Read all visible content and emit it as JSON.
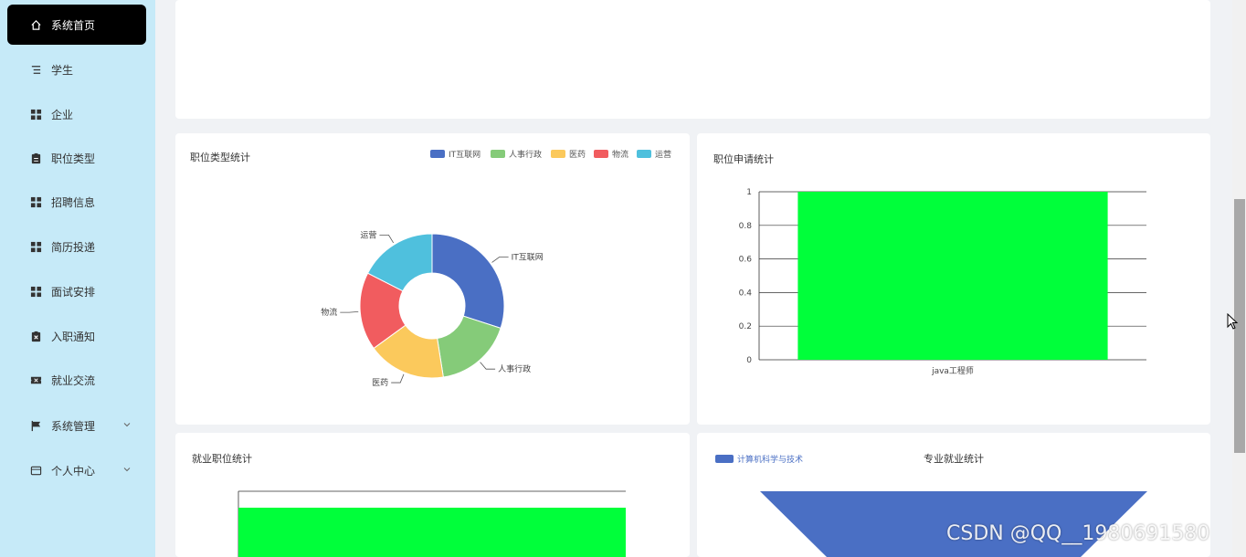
{
  "sidebar": {
    "items": [
      {
        "label": "系统首页",
        "icon": "home-icon"
      },
      {
        "label": "学生",
        "icon": "list-icon"
      },
      {
        "label": "企业",
        "icon": "grid-icon"
      },
      {
        "label": "职位类型",
        "icon": "clipboard-icon"
      },
      {
        "label": "招聘信息",
        "icon": "grid-icon"
      },
      {
        "label": "简历投递",
        "icon": "grid-icon"
      },
      {
        "label": "面试安排",
        "icon": "grid-icon"
      },
      {
        "label": "入职通知",
        "icon": "clipboard-x-icon"
      },
      {
        "label": "就业交流",
        "icon": "ticket-icon"
      },
      {
        "label": "系统管理",
        "icon": "flag-icon"
      },
      {
        "label": "个人中心",
        "icon": "card-icon"
      }
    ]
  },
  "colors": {
    "sidebar_bg": "#c6eaf8",
    "active_bg": "#000000",
    "bar_green": "#00ff3a",
    "funnel_blue": "#4a6fc4"
  },
  "charts": {
    "job_type": {
      "title": "职位类型统计"
    },
    "job_apply": {
      "title": "职位申请统计"
    },
    "employment_position": {
      "title": "就业职位统计"
    },
    "major_employment": {
      "title": "专业就业统计"
    }
  },
  "watermark": "CSDN @QQ__1980691580",
  "chart_data": [
    {
      "type": "pie",
      "title": "职位类型统计",
      "legend_position": "top-right",
      "categories": [
        "IT互联网",
        "人事行政",
        "医药",
        "物流",
        "运营"
      ],
      "values": [
        30,
        17.5,
        17.5,
        17.5,
        17.5
      ],
      "colors": [
        "#4a6fc4",
        "#85cb79",
        "#fbc95c",
        "#f15c5f",
        "#4fc0dd"
      ]
    },
    {
      "type": "bar",
      "title": "职位申请统计",
      "categories": [
        "java工程师"
      ],
      "values": [
        1
      ],
      "ylim": [
        0,
        1
      ],
      "yticks": [
        "0",
        "0.2",
        "0.4",
        "0.6",
        "0.8",
        "1"
      ],
      "grid": true
    },
    {
      "type": "bar",
      "title": "就业职位统计",
      "categories": [
        ""
      ],
      "values": [
        0.9
      ],
      "ylim": [
        0,
        1
      ]
    },
    {
      "type": "funnel",
      "title": "专业就业统计",
      "categories": [
        "计算机科学与技术"
      ],
      "values": [
        1
      ]
    }
  ]
}
